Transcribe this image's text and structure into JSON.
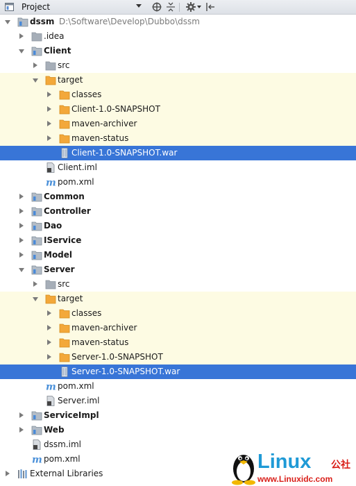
{
  "toolbar": {
    "title": "Project"
  },
  "tree": [
    {
      "d": 0,
      "exp": "down",
      "icon": "module-icon",
      "label": "dssm",
      "bold": true,
      "path": "D:\\Software\\Develop\\Dubbo\\dssm"
    },
    {
      "d": 1,
      "exp": "right",
      "icon": "folder-gray-icon",
      "label": ".idea"
    },
    {
      "d": 1,
      "exp": "down",
      "icon": "module-icon",
      "label": "Client",
      "bold": true
    },
    {
      "d": 2,
      "exp": "right",
      "icon": "folder-gray-icon",
      "label": "src"
    },
    {
      "d": 2,
      "exp": "down",
      "icon": "folder-orange-icon",
      "label": "target",
      "band": true
    },
    {
      "d": 3,
      "exp": "right",
      "icon": "folder-orange-icon",
      "label": "classes",
      "band": true
    },
    {
      "d": 3,
      "exp": "right",
      "icon": "folder-orange-icon",
      "label": "Client-1.0-SNAPSHOT",
      "band": true
    },
    {
      "d": 3,
      "exp": "right",
      "icon": "folder-orange-icon",
      "label": "maven-archiver",
      "band": true
    },
    {
      "d": 3,
      "exp": "right",
      "icon": "folder-orange-icon",
      "label": "maven-status",
      "band": true
    },
    {
      "d": 3,
      "exp": "none",
      "icon": "war-file-icon",
      "label": "Client-1.0-SNAPSHOT.war",
      "selected": true
    },
    {
      "d": 2,
      "exp": "none",
      "icon": "iml-file-icon",
      "label": "Client.iml"
    },
    {
      "d": 2,
      "exp": "none",
      "icon": "maven-pom-icon",
      "label": "pom.xml"
    },
    {
      "d": 1,
      "exp": "right",
      "icon": "module-icon",
      "label": "Common",
      "bold": true
    },
    {
      "d": 1,
      "exp": "right",
      "icon": "module-icon",
      "label": "Controller",
      "bold": true
    },
    {
      "d": 1,
      "exp": "right",
      "icon": "module-icon",
      "label": "Dao",
      "bold": true
    },
    {
      "d": 1,
      "exp": "right",
      "icon": "module-icon",
      "label": "IService",
      "bold": true
    },
    {
      "d": 1,
      "exp": "right",
      "icon": "module-icon",
      "label": "Model",
      "bold": true
    },
    {
      "d": 1,
      "exp": "down",
      "icon": "module-icon",
      "label": "Server",
      "bold": true
    },
    {
      "d": 2,
      "exp": "right",
      "icon": "folder-gray-icon",
      "label": "src"
    },
    {
      "d": 2,
      "exp": "down",
      "icon": "folder-orange-icon",
      "label": "target",
      "band": true
    },
    {
      "d": 3,
      "exp": "right",
      "icon": "folder-orange-icon",
      "label": "classes",
      "band": true
    },
    {
      "d": 3,
      "exp": "right",
      "icon": "folder-orange-icon",
      "label": "maven-archiver",
      "band": true
    },
    {
      "d": 3,
      "exp": "right",
      "icon": "folder-orange-icon",
      "label": "maven-status",
      "band": true
    },
    {
      "d": 3,
      "exp": "right",
      "icon": "folder-orange-icon",
      "label": "Server-1.0-SNAPSHOT",
      "band": true
    },
    {
      "d": 3,
      "exp": "none",
      "icon": "war-file-icon",
      "label": "Server-1.0-SNAPSHOT.war",
      "selected": true
    },
    {
      "d": 2,
      "exp": "none",
      "icon": "maven-pom-icon",
      "label": "pom.xml"
    },
    {
      "d": 2,
      "exp": "none",
      "icon": "iml-file-icon",
      "label": "Server.iml"
    },
    {
      "d": 1,
      "exp": "right",
      "icon": "module-icon",
      "label": "ServiceImpl",
      "bold": true
    },
    {
      "d": 1,
      "exp": "right",
      "icon": "module-icon",
      "label": "Web",
      "bold": true
    },
    {
      "d": 1,
      "exp": "none",
      "icon": "iml-file-icon",
      "label": "dssm.iml"
    },
    {
      "d": 1,
      "exp": "none",
      "icon": "maven-pom-icon",
      "label": "pom.xml"
    },
    {
      "d": 0,
      "exp": "right",
      "icon": "libraries-icon",
      "label": "External Libraries"
    }
  ],
  "watermark": {
    "brand": "Linux",
    "brand_cn": "公社",
    "url": "www.Linuxidc.com"
  },
  "colors": {
    "selection": "#3875d7",
    "target_band": "#fdfbe3",
    "folder_orange": "#f0a732",
    "folder_gray": "#9aa3ad"
  }
}
